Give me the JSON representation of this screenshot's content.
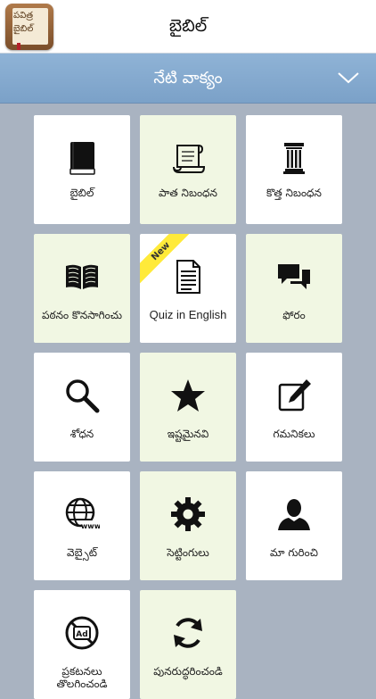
{
  "header": {
    "app_icon_text": "పవిత్ర బైబిల్",
    "title": "బైబిల్"
  },
  "daily_verse": {
    "title": "నేటి వాక్యం"
  },
  "tiles": [
    {
      "label": "బైబిల్",
      "icon": "book-icon"
    },
    {
      "label": "పాత నిబంధన",
      "icon": "scroll-icon"
    },
    {
      "label": "కొత్త నిబంధన",
      "icon": "pillar-icon"
    },
    {
      "label": "పఠనం కొనసాగించు",
      "icon": "open-book-icon"
    },
    {
      "label": "Quiz in English",
      "icon": "document-icon",
      "badge": "New"
    },
    {
      "label": "ఫోరం",
      "icon": "chat-bubbles-icon"
    },
    {
      "label": "శోధన",
      "icon": "search-icon"
    },
    {
      "label": "ఇష్టమైనవి",
      "icon": "star-icon"
    },
    {
      "label": "గమనికలు",
      "icon": "edit-note-icon"
    },
    {
      "label": "వెబ్సైట్",
      "icon": "globe-icon"
    },
    {
      "label": "సెట్టింగులు",
      "icon": "gear-icon"
    },
    {
      "label": "మా గురించి",
      "icon": "user-icon"
    },
    {
      "label": "ప్రకటనలు తొలగించండి",
      "icon": "no-ads-icon"
    },
    {
      "label": "పునరుద్ధరించండి",
      "icon": "refresh-icon"
    }
  ],
  "colors": {
    "background": "#a9b3c1",
    "header_bar": "#ffffff",
    "verse_bar": "#8fb3d6",
    "tile_white": "#ffffff",
    "tile_green": "#f1f7e3",
    "badge": "#ffea3a"
  }
}
